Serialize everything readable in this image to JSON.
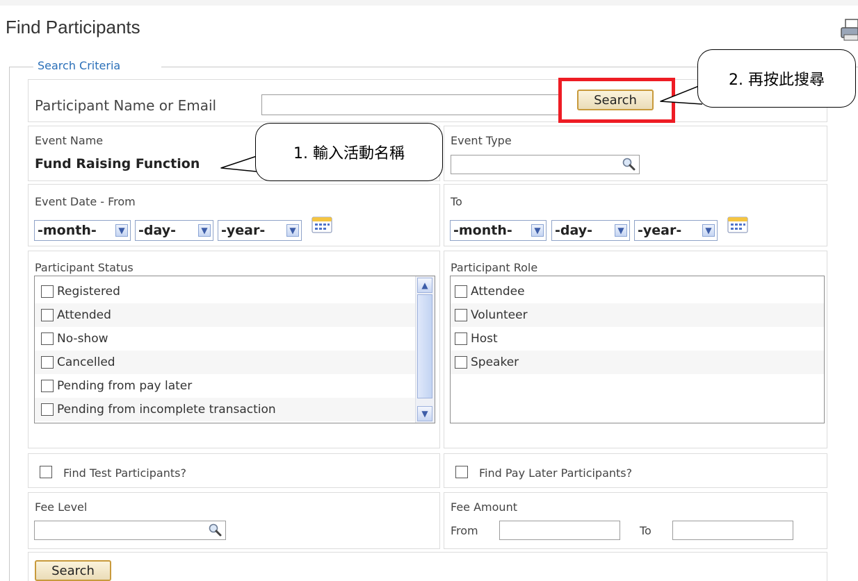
{
  "page": {
    "title": "Find Participants"
  },
  "search_criteria": {
    "legend": "Search Criteria",
    "participant_name": {
      "label": "Participant Name or Email",
      "value": ""
    },
    "search_label": "Search",
    "event_name": {
      "label": "Event Name",
      "value": "Fund Raising Function"
    },
    "event_type": {
      "label": "Event Type",
      "value": ""
    },
    "event_date_from": {
      "label": "Event Date - From",
      "month": "-month-",
      "day": "-day-",
      "year": "-year-"
    },
    "event_date_to": {
      "label": "To",
      "month": "-month-",
      "day": "-day-",
      "year": "-year-"
    },
    "participant_status": {
      "label": "Participant Status",
      "options": [
        "Registered",
        "Attended",
        "No-show",
        "Cancelled",
        "Pending from pay later",
        "Pending from incomplete transaction"
      ]
    },
    "participant_role": {
      "label": "Participant Role",
      "options": [
        "Attendee",
        "Volunteer",
        "Host",
        "Speaker"
      ]
    },
    "find_test": "Find Test Participants?",
    "find_pay_later": "Find Pay Later Participants?",
    "fee_level": {
      "label": "Fee Level",
      "value": ""
    },
    "fee_amount": {
      "label": "Fee Amount",
      "from_label": "From",
      "to_label": "To",
      "from_value": "",
      "to_value": ""
    },
    "bottom_search_label": "Search"
  },
  "annotations": {
    "step1": "1. 輸入活動名稱",
    "step2": "2. 再按此搜尋"
  },
  "colors": {
    "highlight": "#ee1c24",
    "legend": "#2a6fb8",
    "button_border": "#c89a3c"
  }
}
